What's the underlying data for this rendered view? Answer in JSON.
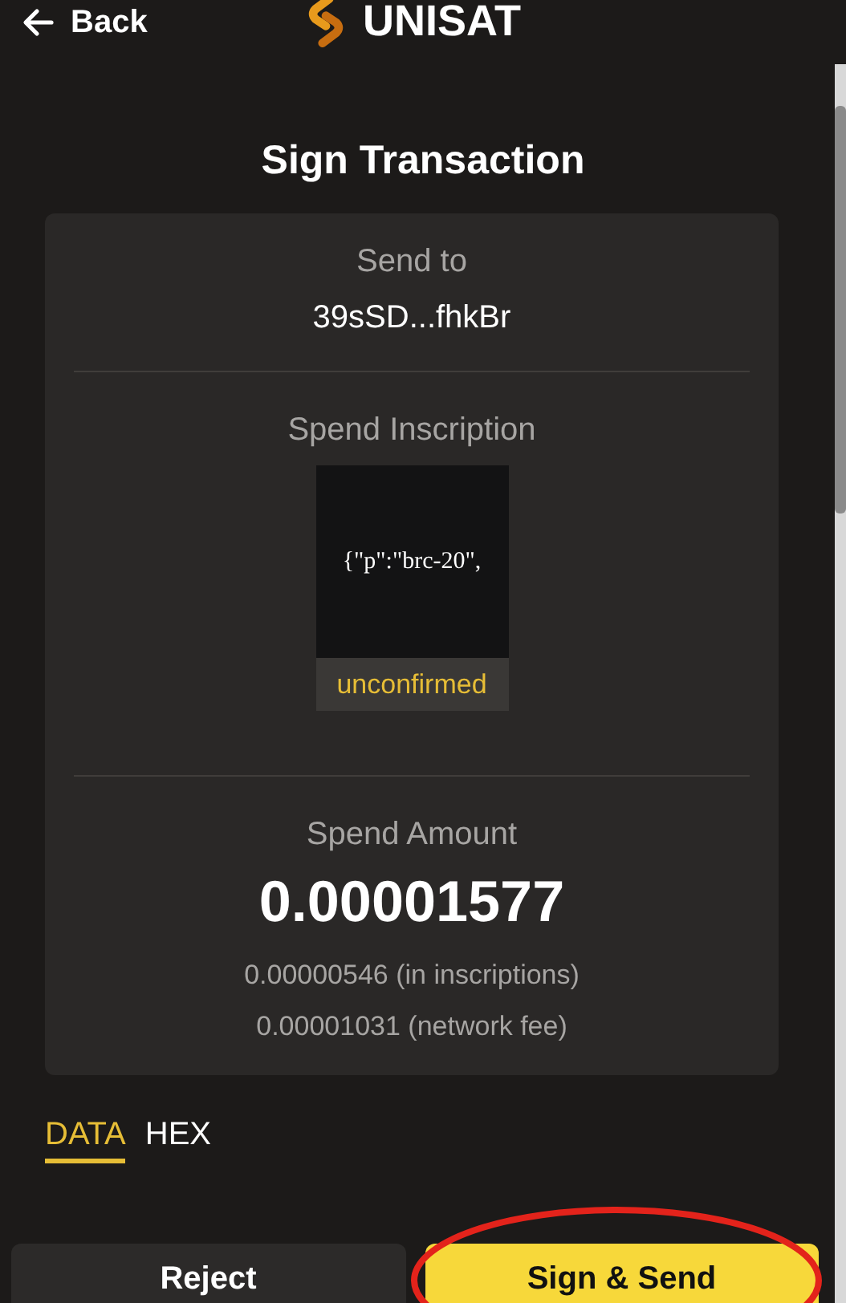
{
  "header": {
    "back_label": "Back",
    "brand": "UNISAT"
  },
  "title": "Sign Transaction",
  "card": {
    "send_to_label": "Send to",
    "send_to_address": "39sSD...fhkBr",
    "inscription_label": "Spend Inscription",
    "inscription_content": "{\"p\":\"brc-20\",",
    "inscription_status": "unconfirmed",
    "amount_label": "Spend Amount",
    "amount": "0.00001577",
    "details": [
      "0.00000546 (in inscriptions)",
      "0.00001031 (network fee)"
    ]
  },
  "tabs": [
    {
      "label": "DATA",
      "selected": true
    },
    {
      "label": "HEX",
      "selected": false
    }
  ],
  "buttons": [
    {
      "label": "Reject",
      "kind": "secondary"
    },
    {
      "label": "Sign & Send",
      "kind": "primary"
    }
  ],
  "annotation": {
    "kind": "ellipse",
    "color": "#e3231b"
  }
}
